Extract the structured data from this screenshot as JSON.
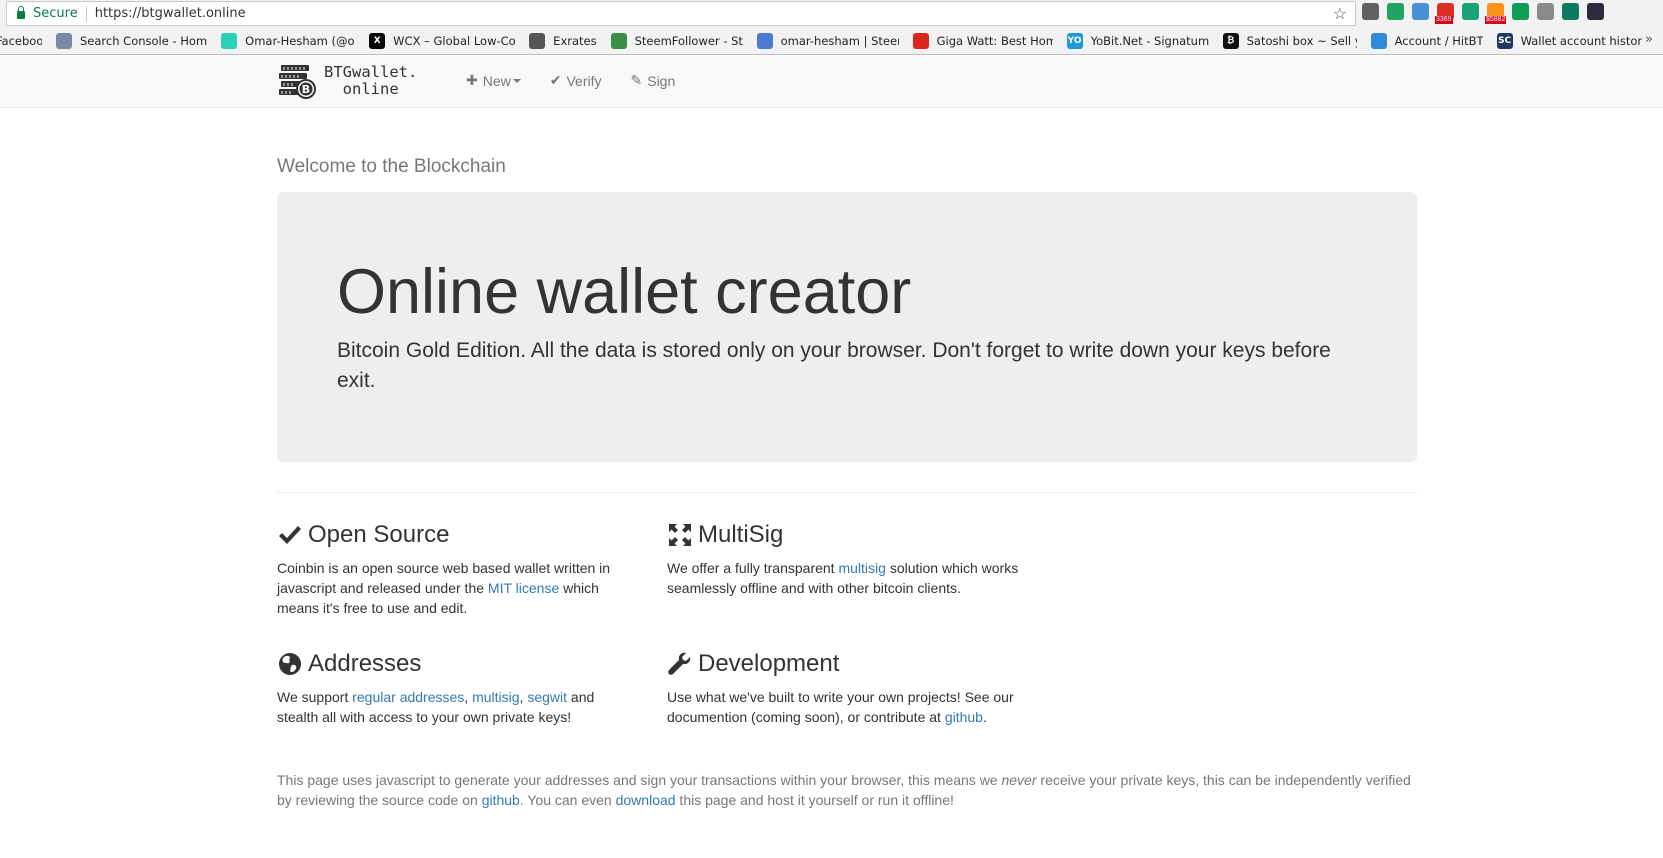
{
  "browser": {
    "secure_label": "Secure",
    "url": "https://btgwallet.online",
    "extensions": [
      {
        "name": "bulb",
        "color": "#616161",
        "badge": ""
      },
      {
        "name": "drive",
        "color": "#1fa463",
        "badge": ""
      },
      {
        "name": "person",
        "color": "#4a90d9",
        "badge": ""
      },
      {
        "name": "gmail",
        "color": "#d93025",
        "badge": "3369"
      },
      {
        "name": "key",
        "color": "#1aa37a",
        "badge": ""
      },
      {
        "name": "bitcoin",
        "color": "#f7931a",
        "badge": "$5882"
      },
      {
        "name": "phone",
        "color": "#0f9d58",
        "badge": ""
      },
      {
        "name": "eye",
        "color": "#8a8a8a",
        "badge": ""
      },
      {
        "name": "pause-badge",
        "color": "#0b7a5e",
        "badge": ""
      },
      {
        "name": "avatar",
        "color": "#2b2b3b",
        "badge": ""
      }
    ],
    "bookmarks": [
      {
        "label": "Facebook",
        "icon_color": "",
        "icon_text": ""
      },
      {
        "label": "Search Console - Hom",
        "icon_color": "#7a8aa6",
        "icon_text": ""
      },
      {
        "label": "Omar-Hesham (@om",
        "icon_color": "#2bd1b4",
        "icon_text": ""
      },
      {
        "label": "WCX – Global Low-Co",
        "icon_color": "#000000",
        "icon_text": "X"
      },
      {
        "label": "Exrates",
        "icon_color": "#555555",
        "icon_text": ""
      },
      {
        "label": "SteemFollower - Stee",
        "icon_color": "#3a8f45",
        "icon_text": ""
      },
      {
        "label": "omar-hesham | Steem",
        "icon_color": "#4a7bd1",
        "icon_text": ""
      },
      {
        "label": "Giga Watt: Best Home",
        "icon_color": "#d9251d",
        "icon_text": ""
      },
      {
        "label": "YoBit.Net - Signatum",
        "icon_color": "#1a9ad6",
        "icon_text": "YO"
      },
      {
        "label": "Satoshi box ~ Sell you",
        "icon_color": "#111111",
        "icon_text": "₿"
      },
      {
        "label": "Account / HitBTC",
        "icon_color": "#2e8bd8",
        "icon_text": ""
      },
      {
        "label": "Wallet account histor",
        "icon_color": "#1e3a5f",
        "icon_text": "SC"
      }
    ],
    "more_label": "»"
  },
  "navbar": {
    "brand_line1": "BTGwallet.",
    "brand_line2": "online",
    "items": [
      {
        "label": "New",
        "icon": "plus-icon",
        "dropdown": true
      },
      {
        "label": "Verify",
        "icon": "check-icon",
        "dropdown": false
      },
      {
        "label": "Sign",
        "icon": "pencil-icon",
        "dropdown": false
      }
    ]
  },
  "main": {
    "welcome": "Welcome to the Blockchain",
    "jumbotron": {
      "title": "Online wallet creator",
      "subtitle": "Bitcoin Gold Edition. All the data is stored only on your browser. Don't forget to write down your keys before exit."
    },
    "features": {
      "open_source": {
        "title": "Open Source",
        "text1": "Coinbin is an open source web based wallet written in javascript and released under the ",
        "link": "MIT license",
        "text2": " which means it's free to use and edit."
      },
      "multisig": {
        "title": "MultiSig",
        "text1": "We offer a fully transparent ",
        "link": "multisig",
        "text2": " solution which works seamlessly offline and with other bitcoin clients."
      },
      "addresses": {
        "title": "Addresses",
        "text1": "We support ",
        "link1": "regular addresses",
        "sep1": ", ",
        "link2": "multisig",
        "sep2": ", ",
        "link3": "segwit",
        "text2": " and stealth all with access to your own private keys!"
      },
      "development": {
        "title": "Development",
        "text1": "Use what we've built to write your own projects! See our documention (coming soon), or contribute at ",
        "link": "github",
        "text2": "."
      }
    },
    "footer": {
      "text1": "This page uses javascript to generate your addresses and sign your transactions within your browser, this means we ",
      "emph": "never",
      "text2": " receive your private keys, this can be independently verified by reviewing the source code on ",
      "link1": "github",
      "text3": ". You can even ",
      "link2": "download",
      "text4": " this page and host it yourself or run it offline!"
    }
  }
}
